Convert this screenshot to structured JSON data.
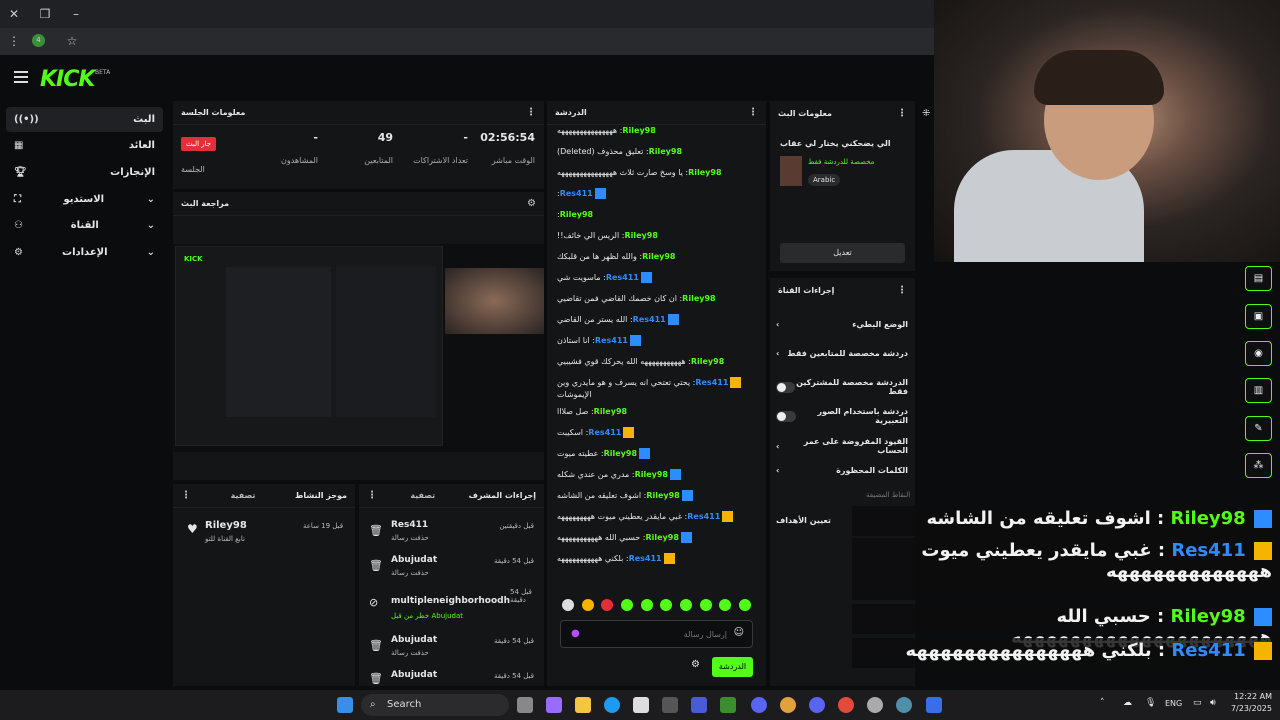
{
  "browser": {
    "extension_badge": "4"
  },
  "header": {
    "logo": "KICK",
    "beta": "BETA"
  },
  "sidebar": {
    "items": [
      {
        "label": "البث",
        "icon": "broadcast-icon"
      },
      {
        "label": "العائد",
        "icon": "revenue-icon"
      },
      {
        "label": "الإنجازات",
        "icon": "trophy-icon"
      },
      {
        "label": "الاستديو",
        "icon": "studio-icon"
      },
      {
        "label": "القناة",
        "icon": "channel-icon"
      },
      {
        "label": "الإعدادات",
        "icon": "gear-icon"
      }
    ]
  },
  "session": {
    "title": "معلومات الجلسة",
    "live_badge": "جار البث",
    "session_label": "الجلسة",
    "stats": [
      {
        "value": "-",
        "label": "المشاهدون"
      },
      {
        "value": "49",
        "label": "المتابعين"
      },
      {
        "value": "-",
        "label": "تعداد الاشتراكات"
      },
      {
        "value": "02:56:54",
        "label": "الوقت مباشر"
      }
    ]
  },
  "preview": {
    "title": "مراجعة البث"
  },
  "activity": {
    "title": "موجز النشاط",
    "filter": "تصفية",
    "user": "Riley98",
    "action": "تابع القناة للتو",
    "time": "قبل 19 ساعة"
  },
  "mod": {
    "title": "إجراءات المشرف",
    "filter": "تصفية",
    "entries": [
      {
        "user": "Res411",
        "action": "حذفت رسالة",
        "time": "قبل دقيقتين"
      },
      {
        "user": "Abujudat",
        "action": "حذفت رسالة",
        "time": "قبل 54 دقيقة"
      },
      {
        "user": "multipleneighborhoodh",
        "action": "خطر من قبل Abujudat",
        "time": "قبل 54 دقيقة"
      },
      {
        "user": "Abujudat",
        "action": "حذفت رسالة",
        "time": "قبل 54 دقيقة"
      },
      {
        "user": "Abujudat",
        "action": "حذفت رسالة",
        "time": "قبل 54 دقيقة"
      }
    ]
  },
  "chat": {
    "title": "الدردشة",
    "input_placeholder": "إرسال رسالة",
    "send_label": "الدردشة",
    "messages": [
      {
        "user": "Riley98",
        "badge": "",
        "text": "هههههههههههههههه"
      },
      {
        "user": "Riley98",
        "badge": "",
        "text": "تعليق محذوف (Deleted)"
      },
      {
        "user": "Riley98",
        "badge": "",
        "text": "يا وسخ صارت ثلاث هههههههههههههههه"
      },
      {
        "user": "Res411",
        "badge": "blue",
        "text": ""
      },
      {
        "user": "Riley98",
        "badge": "",
        "text": ""
      },
      {
        "user": "Riley98",
        "badge": "",
        "text": "الريس الي خائف!!"
      },
      {
        "user": "Riley98",
        "badge": "",
        "text": "والله لظهر ها من قلبكك"
      },
      {
        "user": "Res411",
        "badge": "blue",
        "text": "ماسويت شي"
      },
      {
        "user": "Riley98",
        "badge": "",
        "text": "ان كان خصمك القاضي فمن تقاضيي"
      },
      {
        "user": "Res411",
        "badge": "blue",
        "text": "الله يستر من القاضي"
      },
      {
        "user": "Res411",
        "badge": "blue",
        "text": "انا استاذن"
      },
      {
        "user": "Riley98",
        "badge": "",
        "text": "هههههههههههه الله يحركك قوي فشيبيي"
      },
      {
        "user": "Res411",
        "badge": "gold",
        "text": "يحتي تعتحي انه يسرف و هو مايدري وين الإيموشات"
      },
      {
        "user": "Riley98",
        "badge": "",
        "text": "صل صلااا"
      },
      {
        "user": "Res411",
        "badge": "gold",
        "text": "اسكيبت"
      },
      {
        "user": "Riley98",
        "badge": "blue",
        "text": "عطيته ميوت"
      },
      {
        "user": "Riley98",
        "badge": "blue",
        "text": "مدري من عندي شكله"
      },
      {
        "user": "Riley98",
        "badge": "blue",
        "text": "اشوف تعليقه من الشاشه"
      },
      {
        "user": "Res411",
        "badge": "gold",
        "text": "غبي مايقدر يعطيني ميوت هههههههههه"
      },
      {
        "user": "Riley98",
        "badge": "blue",
        "text": "حسبي الله هههههههههههه"
      },
      {
        "user": "Res411",
        "badge": "gold",
        "text": "بلكني هههههههههههه"
      }
    ]
  },
  "stream_info": {
    "title": "معلومات البث",
    "stream_title": "الي يضحكني يختار لي عقاب",
    "category": "مخصصة للدردشة فقط",
    "language": "Arabic",
    "edit_label": "تعديل"
  },
  "channel_actions": {
    "title": "إجراءات القناة",
    "items": [
      {
        "label": "الوضع البطيء",
        "control": "arrow"
      },
      {
        "label": "دردشة مخصصة للمتابعين فقط",
        "control": "arrow"
      },
      {
        "label": "الدردشة مخصصة للمشتركين فقط",
        "control": "toggle"
      },
      {
        "label": "دردشة باستخدام الصور التعبيرية",
        "control": "toggle"
      },
      {
        "label": "القيود المفروضة على عمر الحساب",
        "control": "arrow"
      },
      {
        "label": "الكلمات المحظورة",
        "control": "arrow"
      }
    ],
    "goals_label": "تعيين الأهداف",
    "channel_points": "النقاط المضيفة"
  },
  "overlay_chat": [
    {
      "user": "Riley98",
      "badge": "blue",
      "text": "اشوف تعليقه من الشاشه"
    },
    {
      "user": "Res411",
      "badge": "gold",
      "text": "غبي مايقدر يعطيني ميوت هههههههههههههه"
    },
    {
      "user": "Riley98",
      "badge": "blue",
      "text": "حسبي الله هههههههههههههههههههههه"
    },
    {
      "user": "Res411",
      "badge": "gold",
      "text": "بلكني هههههههههههههههه"
    }
  ],
  "taskbar": {
    "search_label": "Search",
    "lang": "ENG",
    "time": "12:22 AM",
    "date": "7/23/2025"
  }
}
